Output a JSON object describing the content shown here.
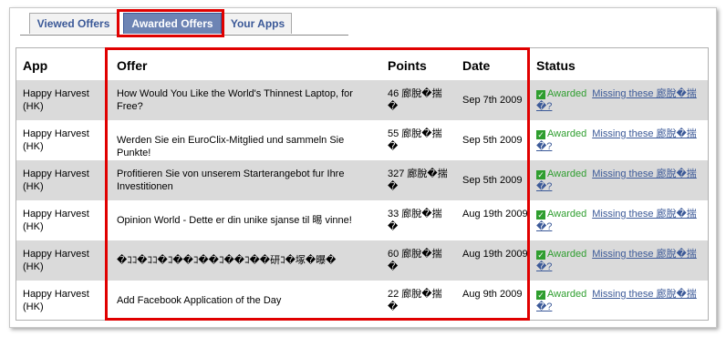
{
  "tabs": [
    {
      "label": "Viewed Offers"
    },
    {
      "label": "Awarded Offers"
    },
    {
      "label": "Your Apps"
    }
  ],
  "table": {
    "headers": {
      "app": "App",
      "offer": "Offer",
      "points": "Points",
      "date": "Date",
      "status": "Status"
    },
    "status_label": "Awarded",
    "missing_link": "Missing these 廊脫�揣�?",
    "rows": [
      {
        "app": "Happy Harvest (HK)",
        "offer": "How Would You Like the World's Thinnest Laptop, for Free?",
        "points": "46 廊脫�揣�",
        "date": "Sep 7th 2009"
      },
      {
        "app": "Happy Harvest (HK)",
        "offer": "Werden Sie ein EuroClix-Mitglied und sammeln Sie Punkte!",
        "points": "55 廊脫�揣�",
        "date": "Sep 5th 2009"
      },
      {
        "app": "Happy Harvest (HK)",
        "offer": "Profitieren Sie von unserem Starterangebot fur Ihre Investitionen",
        "points": "327 廊脫�揣�",
        "date": "Sep 5th 2009"
      },
      {
        "app": "Happy Harvest (HK)",
        "offer": "Opinion World - Dette er din unike sjanse til 晹 vinne!",
        "points": "33 廊脫�揣�",
        "date": "Aug 19th 2009"
      },
      {
        "app": "Happy Harvest (HK)",
        "offer": "�ｺｺ�ｺｺ�ｺ��ｺ��ｺ��ｺ��研ｺ�塚�曝�",
        "points": "60 廊脫�揣�",
        "date": "Aug 19th 2009"
      },
      {
        "app": "Happy Harvest (HK)",
        "offer": "Add Facebook Application of the Day",
        "points": "22 廊脫�揣�",
        "date": "Aug 9th 2009"
      }
    ]
  }
}
